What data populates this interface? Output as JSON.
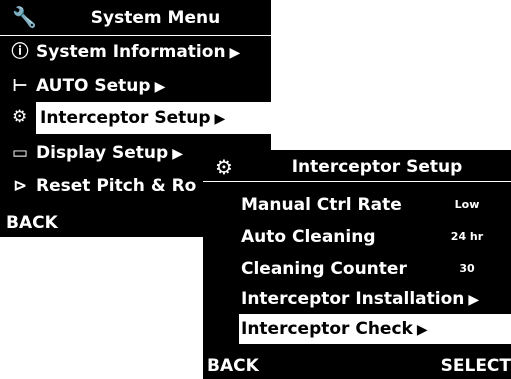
{
  "main_menu": {
    "title": "System Menu",
    "title_icon": "wrench-icon",
    "items": [
      {
        "label": "System Information",
        "icon": "info-icon",
        "glyph": "⓵",
        "arrow": "▶"
      },
      {
        "label": "AUTO Setup",
        "icon": "auto-setup-icon",
        "glyph": "⊢",
        "arrow": "▶"
      },
      {
        "label": "Interceptor Setup",
        "icon": "interceptor-icon",
        "glyph": "⚙",
        "arrow": "▶",
        "selected": true
      },
      {
        "label": "Display Setup",
        "icon": "display-icon",
        "glyph": "▭",
        "arrow": "▶"
      },
      {
        "label": "Reset Pitch & Ro",
        "icon": "reset-icon",
        "glyph": "⊳",
        "arrow": ""
      }
    ],
    "back_label": "BACK"
  },
  "sub_menu": {
    "title": "Interceptor Setup",
    "title_icon": "interceptor-icon",
    "items": [
      {
        "label": "Manual Ctrl Rate",
        "value": "Low"
      },
      {
        "label": "Auto Cleaning",
        "value": "24 hr"
      },
      {
        "label": "Cleaning Counter",
        "value": "30"
      },
      {
        "label": "Interceptor Installation",
        "arrow": "▶"
      },
      {
        "label": "Interceptor Check",
        "arrow": "▶",
        "selected": true
      }
    ],
    "back_label": "BACK",
    "select_label": "SELECT"
  }
}
